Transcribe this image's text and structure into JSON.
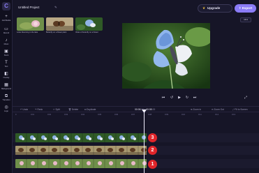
{
  "sidebar": {
    "logo": "C",
    "items": [
      {
        "icon": "+",
        "label": "Add Media"
      },
      {
        "icon": "▭",
        "label": "Record"
      },
      {
        "icon": "♪",
        "label": "Music"
      },
      {
        "icon": "▣",
        "label": "Stock"
      },
      {
        "icon": "T",
        "label": "Text"
      },
      {
        "icon": "◧",
        "label": "Overlay"
      },
      {
        "icon": "▦",
        "label": "Background"
      },
      {
        "icon": "⧉",
        "label": "Transition"
      },
      {
        "icon": "◎",
        "label": "Logo"
      }
    ]
  },
  "header": {
    "title": "Untitled Project",
    "edit_icon": "✎",
    "upgrade_label": "Upgrade",
    "export_label": "Export",
    "ratio_label": "16:9"
  },
  "media": [
    {
      "label": "Lotus blooming in the lake"
    },
    {
      "label": "Butterfly on a flower plant"
    },
    {
      "label": "Video of butterfly on a flower"
    }
  ],
  "player": {
    "back_icon": "⏮",
    "rewind_icon": "↺",
    "play_icon": "▶",
    "forward_icon": "↻",
    "next_icon": "⏭",
    "fullscreen_icon": "⤢"
  },
  "toolbar": {
    "undo": "↶ Undo",
    "redo": "↷ Redo",
    "split": "✂ Split",
    "delete": "🗑 Delete",
    "duplicate": "⧉ Duplicate",
    "time_current": "00:06",
    "time_fraction": ".50",
    "time_separator": " / ",
    "time_total": "00:08",
    "time_total_fraction": ".00",
    "zoom_in": "⊕ Zoom in",
    "zoom_out": "⊖ Zoom Out",
    "fit": "⤢ Fit to Screen"
  },
  "ruler": {
    "ticks": [
      "0",
      "0:01",
      "0:02",
      "0:03",
      "0:04",
      "0:05",
      "0:06",
      "0:07",
      "0:08",
      "0:09",
      "0:10",
      "0:11",
      "0:12",
      "0:13"
    ]
  },
  "timeline": {
    "badges": [
      "3",
      "2",
      "1"
    ]
  },
  "colors": {
    "background": "#161527",
    "accent": "#8b7cf6",
    "badge": "#e0252a"
  }
}
